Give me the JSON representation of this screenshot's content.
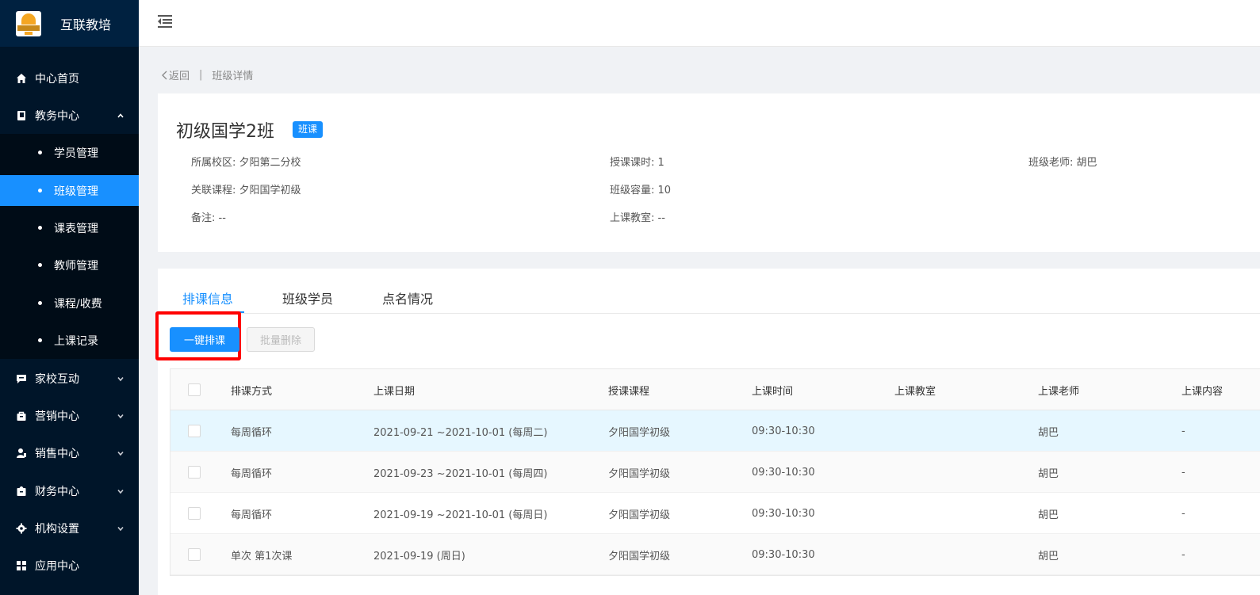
{
  "brand": {
    "name": "互联教培"
  },
  "sidebar": {
    "items": [
      {
        "label": "中心首页"
      },
      {
        "label": "教务中心"
      },
      {
        "label": "家校互动"
      },
      {
        "label": "营销中心"
      },
      {
        "label": "销售中心"
      },
      {
        "label": "财务中心"
      },
      {
        "label": "机构设置"
      },
      {
        "label": "应用中心"
      }
    ],
    "sub_items": [
      {
        "label": "学员管理"
      },
      {
        "label": "班级管理"
      },
      {
        "label": "课表管理"
      },
      {
        "label": "教师管理"
      },
      {
        "label": "课程/收费"
      },
      {
        "label": "上课记录"
      }
    ]
  },
  "breadcrumb": {
    "back": "返回",
    "current": "班级详情"
  },
  "class_info": {
    "title": "初级国学2班",
    "badge": "班课",
    "campus": "所属校区: 夕阳第二分校",
    "course": "关联课程: 夕阳国学初级",
    "remark": "备注: --",
    "hours": "授课课时: 1",
    "capacity": "班级容量: 10",
    "classroom": "上课教室: --",
    "teacher": "班级老师:  胡巴"
  },
  "tabs": [
    {
      "label": "排课信息"
    },
    {
      "label": "班级学员"
    },
    {
      "label": "点名情况"
    }
  ],
  "actions": {
    "schedule": "一键排课",
    "batch_delete": "批量删除"
  },
  "table": {
    "headers": [
      "排课方式",
      "上课日期",
      "授课课程",
      "上课时间",
      "上课教室",
      "上课老师",
      "上课内容"
    ],
    "rows": [
      {
        "mode": "每周循环",
        "date": "2021-09-21 ~2021-10-01 (每周二)",
        "course": "夕阳国学初级",
        "time": "09:30-10:30",
        "room": "",
        "teacher": "胡巴",
        "content": "-"
      },
      {
        "mode": "每周循环",
        "date": "2021-09-23 ~2021-10-01 (每周四)",
        "course": "夕阳国学初级",
        "time": "09:30-10:30",
        "room": "",
        "teacher": "胡巴",
        "content": "-"
      },
      {
        "mode": "每周循环",
        "date": "2021-09-19 ~2021-10-01 (每周日)",
        "course": "夕阳国学初级",
        "time": "09:30-10:30",
        "room": "",
        "teacher": "胡巴",
        "content": "-"
      },
      {
        "mode": "单次 第1次课",
        "date": "2021-09-19 (周日)",
        "course": "夕阳国学初级",
        "time": "09:30-10:30",
        "room": "",
        "teacher": "胡巴",
        "content": "-"
      }
    ]
  },
  "colors": {
    "sidebar_bg": "#001529",
    "submenu_bg": "#000c17",
    "accent": "#1890ff",
    "highlight_box": "#ff0000"
  }
}
